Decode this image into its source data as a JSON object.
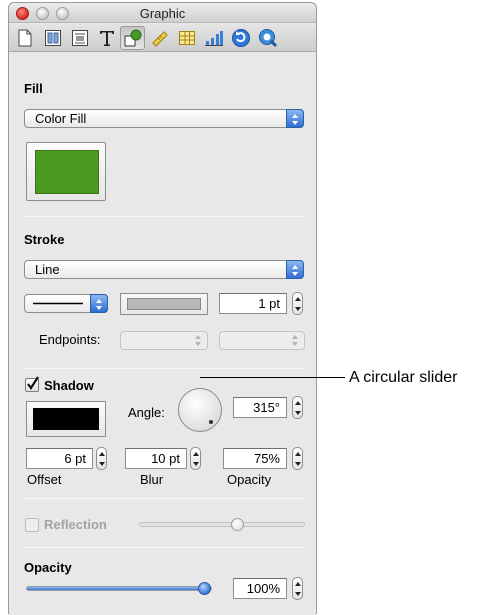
{
  "window": {
    "title": "Graphic"
  },
  "toolbar": {
    "icons": [
      "document-icon",
      "layout-icon",
      "wrap-icon",
      "text-icon",
      "graphic-icon",
      "metrics-icon",
      "table-icon",
      "chart-icon",
      "link-icon",
      "qt-icon"
    ],
    "selected": "graphic-icon"
  },
  "fill": {
    "label": "Fill",
    "type": "Color Fill",
    "color": "#4c9a24"
  },
  "stroke": {
    "label": "Stroke",
    "type": "Line",
    "width_value": "1 pt",
    "endpoints_label": "Endpoints:",
    "stroke_color": "#b8b8b8"
  },
  "shadow": {
    "label": "Shadow",
    "checked": true,
    "color": "#000000",
    "angle_label": "Angle:",
    "angle_value": "315°",
    "offset_value": "6 pt",
    "offset_label": "Offset",
    "blur_value": "10 pt",
    "blur_label": "Blur",
    "opacity_value": "75%",
    "opacity_label": "Opacity"
  },
  "reflection": {
    "label": "Reflection",
    "checked": false,
    "level": 0.6
  },
  "opacity": {
    "label": "Opacity",
    "value": "100%",
    "level": 1.0
  },
  "annotation": {
    "text": "A circular slider"
  }
}
